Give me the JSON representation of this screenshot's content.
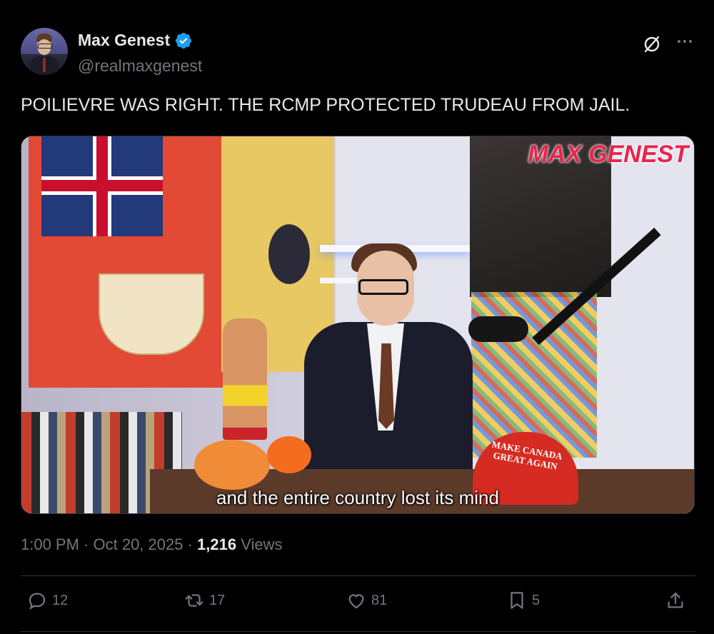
{
  "author": {
    "display_name": "Max Genest",
    "handle": "@realmaxgenest",
    "verified": true
  },
  "tweet": {
    "text": "POILIEVRE WAS RIGHT. THE RCMP PROTECTED TRUDEAU FROM JAIL."
  },
  "media": {
    "watermark": "MAX GENEST",
    "subtitle": "and the entire country lost its mind",
    "hat_text": "MAKE CANADA GREAT AGAIN"
  },
  "meta": {
    "time": "1:00 PM",
    "separator": " · ",
    "date": "Oct 20, 2025",
    "views_count": "1,216",
    "views_label": " Views"
  },
  "actions": {
    "replies": "12",
    "reposts": "17",
    "likes": "81",
    "bookmarks": "5"
  },
  "colors": {
    "background": "#000000",
    "text_primary": "#e7e9ea",
    "text_secondary": "#71767b",
    "verified_blue": "#1d9bf0",
    "divider": "#2f3336"
  }
}
